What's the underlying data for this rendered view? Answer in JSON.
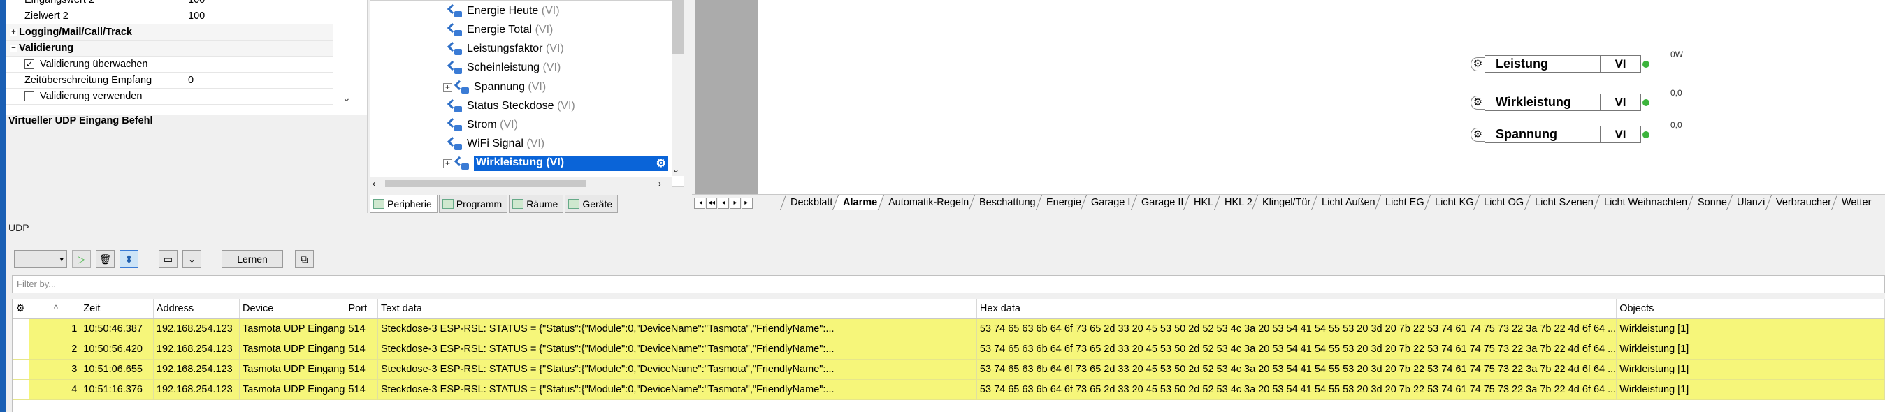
{
  "properties": {
    "rows": [
      {
        "key": "Eingangswert 2",
        "value": "100"
      },
      {
        "key": "Zielwert 2",
        "value": "100"
      }
    ],
    "categories": {
      "logging": "Logging/Mail/Call/Track",
      "validation": "Validierung"
    },
    "validation_rows": [
      {
        "key": "Validierung überwachen",
        "value": "",
        "checked": true
      },
      {
        "key": "Zeitüberschreitung Empfang",
        "value": "0"
      },
      {
        "key": "Validierung verwenden",
        "value": "",
        "checked": false
      }
    ],
    "description_title": "Virtueller UDP Eingang Befehl"
  },
  "tree": {
    "items": [
      {
        "label": "Energie Heute",
        "suffix": "(VI)"
      },
      {
        "label": "Energie Total",
        "suffix": "(VI)"
      },
      {
        "label": "Leistungsfaktor",
        "suffix": "(VI)"
      },
      {
        "label": "Scheinleistung",
        "suffix": "(VI)"
      },
      {
        "label": "Spannung",
        "suffix": "(VI)"
      },
      {
        "label": "Status Steckdose",
        "suffix": "(VI)"
      },
      {
        "label": "Strom",
        "suffix": "(VI)"
      },
      {
        "label": "WiFi Signal",
        "suffix": "(VI)"
      },
      {
        "label": "Wirkleistung",
        "suffix": "(VI)"
      }
    ],
    "tabs": [
      "Peripherie",
      "Programm",
      "Räume",
      "Geräte"
    ]
  },
  "canvas": {
    "nodes": [
      {
        "name": "Leistung",
        "type": "VI",
        "value": "0W"
      },
      {
        "name": "Wirkleistung",
        "type": "VI",
        "value": "0,0"
      },
      {
        "name": "Spannung",
        "type": "VI",
        "value": "0,0"
      }
    ]
  },
  "sheets": [
    "Deckblatt",
    "Alarme",
    "Automatik-Regeln",
    "Beschattung",
    "Energie",
    "Garage I",
    "Garage II",
    "HKL",
    "HKL 2",
    "Klingel/Tür",
    "Licht Außen",
    "Licht EG",
    "Licht KG",
    "Licht OG",
    "Licht Szenen",
    "Licht Weihnachten",
    "Sonne",
    "Ulanzi",
    "Verbraucher",
    "Wetter"
  ],
  "active_sheet": "Alarme",
  "udp": {
    "title": "UDP",
    "learn_button": "Lernen",
    "filter_placeholder": "Filter by...",
    "columns": [
      "Zeit",
      "Address",
      "Device",
      "Port",
      "Text data",
      "Hex data",
      "Objects"
    ],
    "rows": [
      {
        "n": "1",
        "time": "10:50:46.387",
        "address": "192.168.254.123",
        "device": "Tasmota UDP Eingang",
        "port": "514",
        "text": "Steckdose-3 ESP-RSL: STATUS = {\"Status\":{\"Module\":0,\"DeviceName\":\"Tasmota\",\"FriendlyName\":...",
        "hex": "53 74 65 63 6b 64 6f 73 65 2d 33 20 45 53 50 2d 52 53 4c 3a 20 53 54 41 54 55 53 20 3d 20 7b 22 53 74 61 74 75 73 22 3a 7b 22 4d 6f 64 ...",
        "objects": "Wirkleistung [1]"
      },
      {
        "n": "2",
        "time": "10:50:56.420",
        "address": "192.168.254.123",
        "device": "Tasmota UDP Eingang",
        "port": "514",
        "text": "Steckdose-3 ESP-RSL: STATUS = {\"Status\":{\"Module\":0,\"DeviceName\":\"Tasmota\",\"FriendlyName\":...",
        "hex": "53 74 65 63 6b 64 6f 73 65 2d 33 20 45 53 50 2d 52 53 4c 3a 20 53 54 41 54 55 53 20 3d 20 7b 22 53 74 61 74 75 73 22 3a 7b 22 4d 6f 64 ...",
        "objects": "Wirkleistung [1]"
      },
      {
        "n": "3",
        "time": "10:51:06.655",
        "address": "192.168.254.123",
        "device": "Tasmota UDP Eingang",
        "port": "514",
        "text": "Steckdose-3 ESP-RSL: STATUS = {\"Status\":{\"Module\":0,\"DeviceName\":\"Tasmota\",\"FriendlyName\":...",
        "hex": "53 74 65 63 6b 64 6f 73 65 2d 33 20 45 53 50 2d 52 53 4c 3a 20 53 54 41 54 55 53 20 3d 20 7b 22 53 74 61 74 75 73 22 3a 7b 22 4d 6f 64 ...",
        "objects": "Wirkleistung [1]"
      },
      {
        "n": "4",
        "time": "10:51:16.376",
        "address": "192.168.254.123",
        "device": "Tasmota UDP Eingang",
        "port": "514",
        "text": "Steckdose-3 ESP-RSL: STATUS = {\"Status\":{\"Module\":0,\"DeviceName\":\"Tasmota\",\"FriendlyName\":...",
        "hex": "53 74 65 63 6b 64 6f 73 65 2d 33 20 45 53 50 2d 52 53 4c 3a 20 53 54 41 54 55 53 20 3d 20 7b 22 53 74 61 74 75 73 22 3a 7b 22 4d 6f 64 ...",
        "objects": "Wirkleistung [1]"
      }
    ]
  },
  "colors": {
    "row_highlight": "#f6f67a",
    "selection": "#0a64d8",
    "status_green": "#3cb43c"
  }
}
